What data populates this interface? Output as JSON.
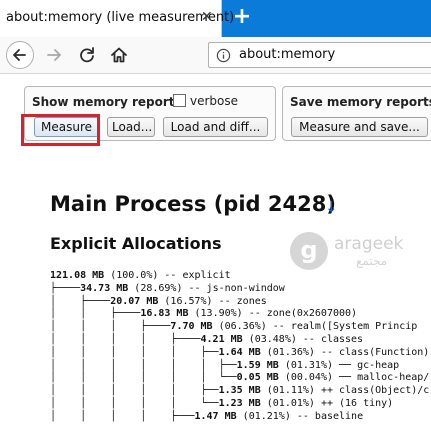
{
  "tab": {
    "title": "about:memory (live measurement)",
    "close_icon": "close-icon"
  },
  "toolbar": {
    "new_tab_label": "+"
  },
  "nav": {
    "url": "about:memory"
  },
  "show_reports": {
    "title": "Show memory reports",
    "verbose_label": "verbose",
    "verbose_checked": false,
    "measure_label": "Measure",
    "load_label": "Load...",
    "load_diff_label": "Load and diff..."
  },
  "save_reports": {
    "title": "Save memory reports",
    "measure_save_label": "Measure and save..."
  },
  "highlight_color": "#d8232a",
  "main": {
    "process_title": "Main Process (pid 2428)",
    "process_link": "↓",
    "section_title": "Explicit Allocations"
  },
  "watermark": {
    "text": "arageek",
    "subtext": "مجتمع"
  },
  "tree": [
    {
      "prefix": "",
      "value": "121.08 MB",
      "rest": " (100.0%) -- explicit"
    },
    {
      "prefix": "├────",
      "value": "34.73 MB",
      "rest": " (28.69%) -- js-non-window"
    },
    {
      "prefix": "│    ├────",
      "value": "20.07 MB",
      "rest": " (16.57%) -- zones"
    },
    {
      "prefix": "│    │    ├────",
      "value": "16.83 MB",
      "rest": " (13.90%) -- zone(0x2607000)"
    },
    {
      "prefix": "│    │    │    ├────",
      "value": "7.70 MB",
      "rest": " (06.36%) -- realm([System Princip"
    },
    {
      "prefix": "│    │    │    │    ├────",
      "value": "4.21 MB",
      "rest": " (03.48%) -- classes"
    },
    {
      "prefix": "│    │    │    │    │    ├──",
      "value": "1.64 MB",
      "rest": " (01.36%) -- class(Function)"
    },
    {
      "prefix": "│    │    │    │    │    │  ├──",
      "value": "1.59 MB",
      "rest": " (01.31%) ── gc-heap"
    },
    {
      "prefix": "│    │    │    │    │    │  └──",
      "value": "0.05 MB",
      "rest": " (00.04%) ── malloc-heap/"
    },
    {
      "prefix": "│    │    │    │    │    ├──",
      "value": "1.35 MB",
      "rest": " (01.11%) ++ class(Object)/c"
    },
    {
      "prefix": "│    │    │    │    │    └──",
      "value": "1.23 MB",
      "rest": " (01.01%) ++ (16 tiny)"
    },
    {
      "prefix": "│    │    │    │    ├───",
      "value": "1.47 MB",
      "rest": " (01.21%) -- baseline"
    }
  ]
}
